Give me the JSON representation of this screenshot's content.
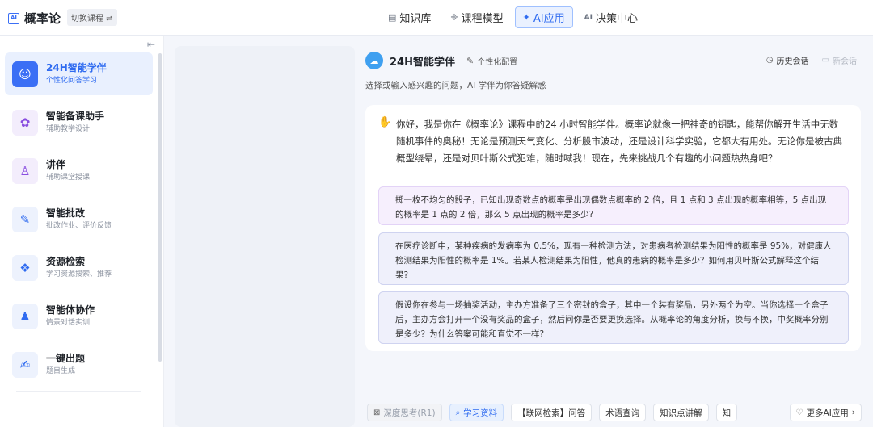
{
  "brand": {
    "icon_text": "AI",
    "title": "概率论",
    "switch_label": "切换课程 ⇌"
  },
  "nav": [
    {
      "icon": "▤",
      "label": "知识库"
    },
    {
      "icon": "❈",
      "label": "课程模型"
    },
    {
      "icon": "✦",
      "label": "AI应用"
    },
    {
      "icon": "AI",
      "label": "决策中心"
    }
  ],
  "sidebar": {
    "collapse_icon": "⇤",
    "items": [
      {
        "icon": "☺",
        "title": "24H智能学伴",
        "sub": "个性化问答学习"
      },
      {
        "icon": "✿",
        "title": "智能备课助手",
        "sub": "辅助教学设计"
      },
      {
        "icon": "♙",
        "title": "讲伴",
        "sub": "辅助课堂授课"
      },
      {
        "icon": "✎",
        "title": "智能批改",
        "sub": "批改作业、评价反馈"
      },
      {
        "icon": "❖",
        "title": "资源检索",
        "sub": "学习资源搜索、推荐"
      },
      {
        "icon": "♟",
        "title": "智能体协作",
        "sub": "情景对话实训"
      },
      {
        "icon": "✍",
        "title": "一键出题",
        "sub": "题目生成"
      }
    ]
  },
  "bot": {
    "avatar": "☁",
    "name": "24H智能学伴",
    "personal_icon": "✎",
    "personal_label": "个性化配置",
    "desc": "选择或输入感兴趣的问题，AI 学伴为你答疑解惑",
    "history_icon": "◷",
    "history_label": "历史会话",
    "new_icon": "▭",
    "new_label": "新会话"
  },
  "chat": {
    "wave_icon": "✋",
    "greeting": "你好，我是你在《概率论》课程中的24 小时智能学伴。概率论就像一把神奇的钥匙，能帮你解开生活中无数随机事件的奥秘！无论是预测天气变化、分析股市波动，还是设计科学实验，它都大有用处。无论你是被古典概型绕晕，还是对贝叶斯公式犯难，随时喊我！现在，先来挑战几个有趣的小问题热热身吧？",
    "questions": [
      "掷一枚不均匀的骰子，已知出现奇数点的概率是出现偶数点概率的 2 倍，且 1 点和 3 点出现的概率相等，5 点出现的概率是 1 点的 2 倍，那么 5 点出现的概率是多少?",
      "在医疗诊断中，某种疾病的发病率为 0.5%，现有一种检测方法，对患病者检测结果为阳性的概率是 95%，对健康人检测结果为阳性的概率是 1%。若某人检测结果为阳性，他真的患病的概率是多少？如何用贝叶斯公式解释这个结果?",
      "假设你在参与一场抽奖活动，主办方准备了三个密封的盒子，其中一个装有奖品，另外两个为空。当你选择一个盒子后，主办方会打开一个没有奖品的盒子，然后问你是否要更换选择。从概率论的角度分析，换与不换，中奖概率分别是多少？为什么答案可能和直觉不一样?"
    ]
  },
  "chips": [
    {
      "icon": "⊠",
      "label": "深度思考(R1)"
    },
    {
      "icon": "⌕",
      "label": "学习资料"
    },
    {
      "icon": "",
      "label": "【联网检索】问答"
    },
    {
      "icon": "",
      "label": "术语查询"
    },
    {
      "icon": "",
      "label": "知识点讲解"
    },
    {
      "icon": "",
      "label": "知"
    }
  ],
  "more_chip": {
    "icon": "♡",
    "label": "更多AI应用",
    "arrow": "›"
  }
}
